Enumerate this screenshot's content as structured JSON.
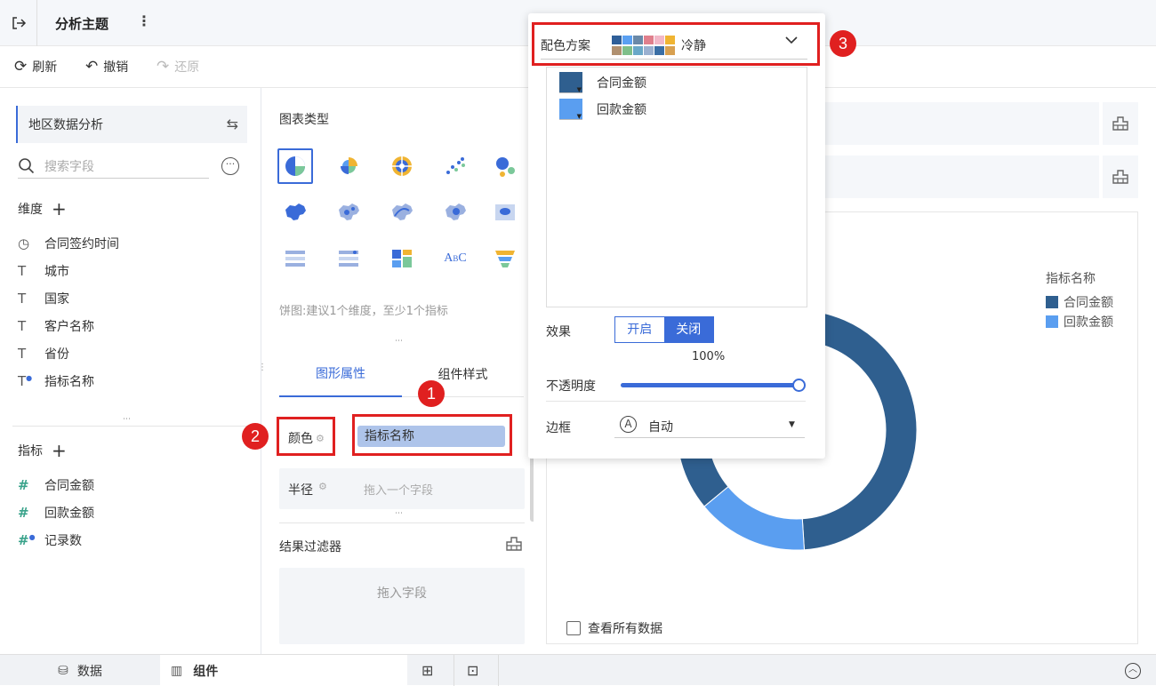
{
  "topbar": {
    "title": "分析主题",
    "back_icon": "exit-icon",
    "more_icon": "more-vertical-icon"
  },
  "toolbar": {
    "refresh": "刷新",
    "undo": "撤销",
    "redo": "还原"
  },
  "dataset": {
    "name": "地区数据分析",
    "search_placeholder": "搜索字段"
  },
  "dimensions": {
    "title": "维度",
    "items": [
      {
        "icon": "clock-icon",
        "label": "合同签约时间"
      },
      {
        "icon": "text-field-icon",
        "label": "城市"
      },
      {
        "icon": "text-field-icon",
        "label": "国家"
      },
      {
        "icon": "text-field-icon",
        "label": "客户名称"
      },
      {
        "icon": "text-field-icon",
        "label": "省份"
      },
      {
        "icon": "calc-text-field-icon",
        "label": "指标名称"
      }
    ]
  },
  "measures": {
    "title": "指标",
    "items": [
      {
        "icon": "number-field-icon",
        "label": "合同金额"
      },
      {
        "icon": "number-field-icon",
        "label": "回款金额"
      },
      {
        "icon": "calc-number-field-icon",
        "label": "记录数"
      }
    ]
  },
  "chart_type": {
    "title": "图表类型",
    "hint": "饼图:建议1个维度，至少1个指标"
  },
  "props": {
    "tab_graphic": "图形属性",
    "tab_style": "组件样式",
    "color_label": "颜色",
    "color_field": "指标名称",
    "radius_label": "半径",
    "radius_placeholder": "拖入一个字段",
    "filter_title": "结果过滤器",
    "filter_placeholder": "拖入字段"
  },
  "popup": {
    "scheme_label": "配色方案",
    "scheme_name": "冷静",
    "scheme_colors": [
      "#2f5f99",
      "#5aa0f2",
      "#6a89a8",
      "#e07f8c",
      "#f2b8c8",
      "#f0b432",
      "#b09070",
      "#7fbf8a",
      "#6aa8c8",
      "#9ab0d0",
      "#3a6ea5",
      "#d8a050"
    ],
    "items": [
      {
        "label": "合同金额",
        "color": "#2f5f8f"
      },
      {
        "label": "回款金额",
        "color": "#5a9ef0"
      }
    ],
    "effect_label": "效果",
    "effect_on": "开启",
    "effect_off": "关闭",
    "opacity_value": "100%",
    "opacity_label": "不透明度",
    "opacity_fraction": 1.0,
    "border_label": "边框",
    "border_value": "自动"
  },
  "chart": {
    "legend_title": "指标名称",
    "view_all": "查看所有数据"
  },
  "chart_data": {
    "type": "pie",
    "categories": [
      "合同金额",
      "回款金额"
    ],
    "values": [
      85,
      15
    ],
    "colors": [
      "#2f5f8f",
      "#5a9ef0"
    ]
  },
  "annotations": {
    "badge1": "1",
    "badge2": "2",
    "badge3": "3"
  },
  "bottom": {
    "data_tab": "数据",
    "component_tab": "组件"
  }
}
